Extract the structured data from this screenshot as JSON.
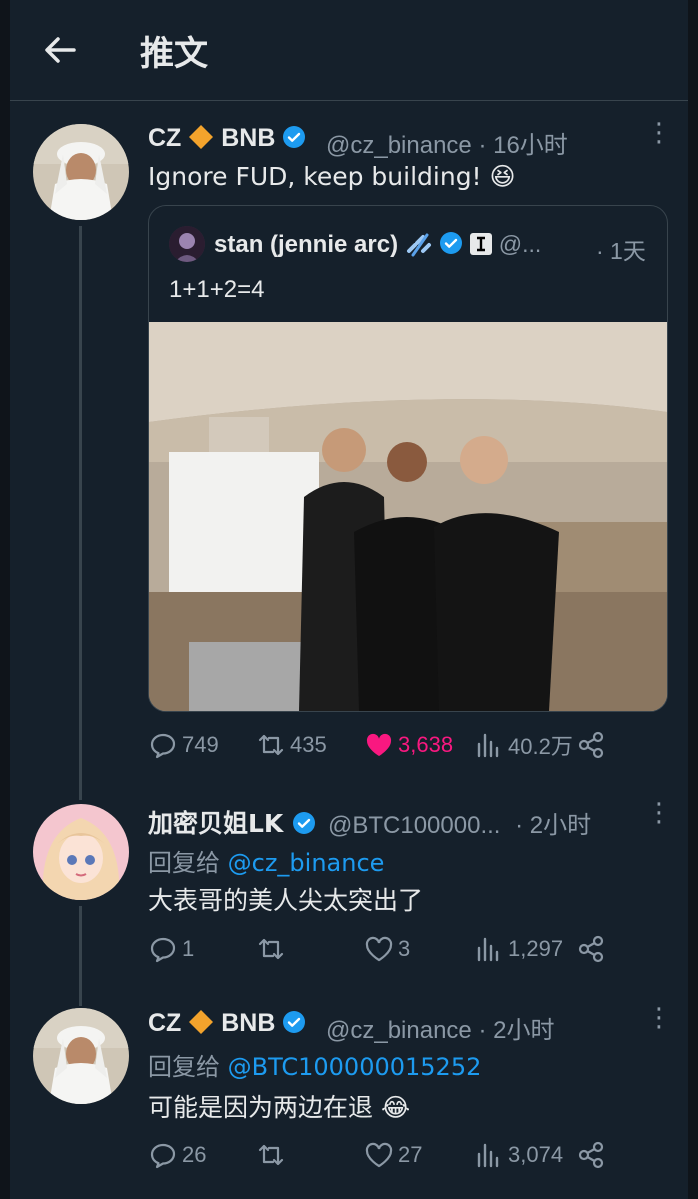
{
  "header": {
    "title": "推文"
  },
  "tweets": [
    {
      "name": "CZ",
      "name_suffix": "BNB",
      "handle": "@cz_binance",
      "time": "· 16小时",
      "text": "Ignore FUD, keep building!",
      "emoji": "😆",
      "quote": {
        "name": "stan (jennie arc)",
        "handle": "@...",
        "time": "· 1天",
        "text": "1+1+2=4"
      },
      "stats": {
        "replies": "749",
        "retweets": "435",
        "likes": "3,638",
        "views": "40.2万"
      }
    },
    {
      "name": "加密贝姐LK",
      "handle": "@BTC100000...",
      "time": "· 2小时",
      "reply_label": "回复给",
      "reply_to": "@cz_binance",
      "text": "大表哥的美人尖太突出了",
      "stats": {
        "replies": "1",
        "retweets": "",
        "likes": "3",
        "views": "1,297"
      }
    },
    {
      "name": "CZ",
      "name_suffix": "BNB",
      "handle": "@cz_binance",
      "time": "· 2小时",
      "reply_label": "回复给",
      "reply_to": "@BTC100000015252",
      "text": "可能是因为两边在退",
      "emoji": "😂",
      "stats": {
        "replies": "26",
        "retweets": "",
        "likes": "27",
        "views": "3,074"
      }
    }
  ],
  "colors": {
    "background": "#15202b",
    "accent": "#1d9bf0",
    "like": "#f91880",
    "muted": "#8b98a5",
    "bnb": "#f3a32c"
  }
}
